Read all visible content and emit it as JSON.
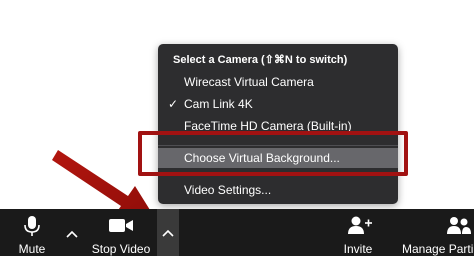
{
  "menu": {
    "heading": "Select a Camera (⇧⌘N to switch)",
    "items": [
      {
        "label": "Wirecast Virtual Camera",
        "checked": false
      },
      {
        "label": "Cam Link 4K",
        "checked": true
      },
      {
        "label": "FaceTime HD Camera (Built-in)",
        "checked": false
      }
    ],
    "virtual_bg_label": "Choose Virtual Background...",
    "video_settings_label": "Video Settings...",
    "check_glyph": "✓"
  },
  "toolbar": {
    "mute_label": "Mute",
    "stop_video_label": "Stop Video",
    "invite_label": "Invite",
    "manage_label": "Manage Parti",
    "caret_glyph": "^"
  },
  "colors": {
    "toolbar_bg": "#1a1a1a",
    "menu_bg": "#2d2d2f",
    "highlight_row": "#67676b",
    "annotation_red": "#a11212"
  },
  "icons": [
    "microphone-icon",
    "video-camera-icon",
    "add-person-icon",
    "people-icon",
    "chevron-up-icon",
    "checkmark-icon",
    "arrow-annotation"
  ]
}
